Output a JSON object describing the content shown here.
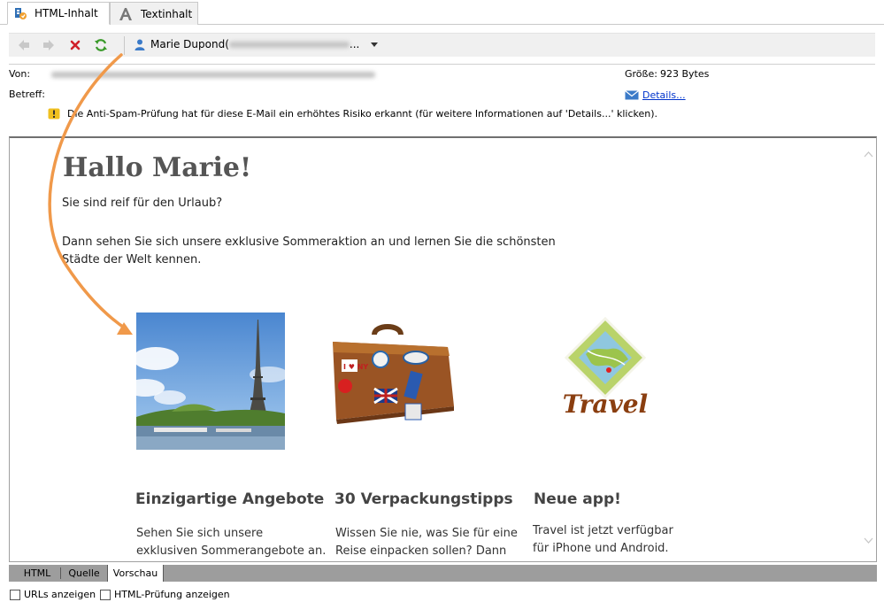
{
  "tabs": [
    {
      "label": "HTML-Inhalt",
      "icon": "html-content-icon",
      "active": true
    },
    {
      "label": "Textinhalt",
      "icon": "text-A-icon",
      "active": false
    }
  ],
  "toolbar": {
    "account_name": "Marie Dupond",
    "account_open": "(",
    "account_ellipsis": "..."
  },
  "header": {
    "from_label": "Von:",
    "subject_label": "Betreff:",
    "size_label": "Größe:",
    "size_value": "923 Bytes",
    "details_link": "Details...",
    "spam_warning": "Die Anti-Spam-Prüfung hat für diese E-Mail ein erhöhtes Risiko erkannt (für weitere Informationen auf 'Details...' klicken)."
  },
  "email": {
    "greeting": "Hallo Marie!",
    "line1": "Sie sind reif für den Urlaub?",
    "line2a": "Dann sehen Sie sich unsere exklusive Sommeraktion an und lernen Sie die schönsten",
    "line2b": "Städte der Welt kennen.",
    "cards": [
      {
        "title": "Einzigartige Angebote",
        "text": "Sehen Sie sich unsere exklusiven Sommerangebote an."
      },
      {
        "title": "30 Verpackungstipps",
        "text": "Wissen Sie nie, was Sie für eine Reise einpacken sollen? Dann ist"
      },
      {
        "title": "Neue app!",
        "text": "Travel ist jetzt verfügbar für iPhone und Android."
      }
    ],
    "travel_logo_text": "Travel",
    "suitcase_sticker_ny": "I ♥ NY"
  },
  "bottom_tabs": [
    {
      "label": "HTML",
      "active": false
    },
    {
      "label": "Quelle",
      "active": false
    },
    {
      "label": "Vorschau",
      "active": true
    }
  ],
  "options": {
    "show_urls": "URLs anzeigen",
    "show_html_check": "HTML-Prüfung anzeigen"
  },
  "colors": {
    "arrow": "#f0994a",
    "link": "#0033cc",
    "refresh": "#3a9a2a",
    "delete": "#d0202a"
  }
}
